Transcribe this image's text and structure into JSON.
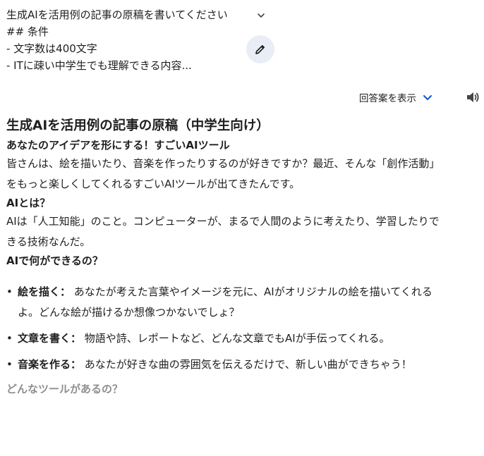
{
  "prompt": {
    "lines": [
      "生成AIを活用例の記事の原稿を書いてください",
      "## 条件",
      " - 文字数は400文字",
      " - ITに疎い中学生でも理解できる内容..."
    ]
  },
  "drafts": {
    "label": "回答案を表示"
  },
  "icons": {
    "expand": "chevron-down-icon",
    "edit": "pencil-icon",
    "drafts": "chevron-down-icon",
    "speaker": "speaker-icon"
  },
  "colors": {
    "accent": "#0b57d0",
    "edit_bg": "#e9eef6",
    "text": "#1f1f1f",
    "faded": "#8e8e8e"
  },
  "response": {
    "title": "生成AIを活用例の記事の原稿（中学生向け）",
    "section1": {
      "heading": "あなたのアイデアを形にする！すごいAIツール",
      "body": "皆さんは、絵を描いたり、音楽を作ったりするのが好きですか？最近、そんな「創作活動」をもっと楽しくしてくれるすごいAIツールが出てきたんです。"
    },
    "section2": {
      "heading": "AIとは？",
      "body": "AIは「人工知能」のこと。コンピューターが、まるで人間のように考えたり、学習したりできる技術なんだ。"
    },
    "section3": {
      "heading": "AIで何ができるの？",
      "items": [
        {
          "term": "絵を描く：",
          "desc": " あなたが考えた言葉やイメージを元に、AIがオリジナルの絵を描いてくれるよ。どんな絵が描けるか想像つかないでしょ？"
        },
        {
          "term": "文章を書く：",
          "desc": " 物語や詩、レポートなど、どんな文章でもAIが手伝ってくれる。"
        },
        {
          "term": "音楽を作る：",
          "desc": " あなたが好きな曲の雰囲気を伝えるだけで、新しい曲ができちゃう！"
        }
      ]
    },
    "section4": {
      "heading": "どんなツールがあるの？"
    }
  }
}
